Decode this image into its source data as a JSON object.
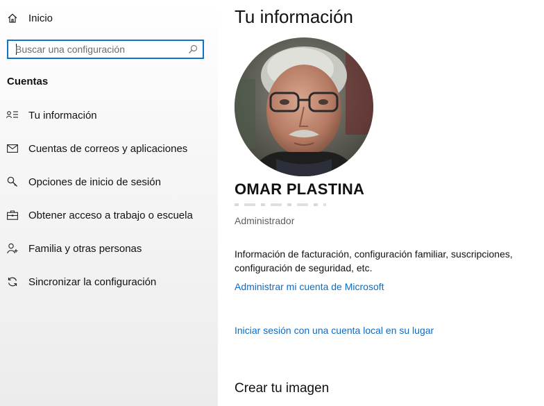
{
  "sidebar": {
    "home_label": "Inicio",
    "search": {
      "placeholder": "Buscar una configuración"
    },
    "section_title": "Cuentas",
    "items": [
      {
        "label": "Tu información",
        "icon": "user-info-icon"
      },
      {
        "label": "Cuentas de correos y aplicaciones",
        "icon": "mail-icon"
      },
      {
        "label": "Opciones de inicio de sesión",
        "icon": "key-icon"
      },
      {
        "label": "Obtener acceso a trabajo o escuela",
        "icon": "briefcase-icon"
      },
      {
        "label": "Familia y otras personas",
        "icon": "person-add-icon"
      },
      {
        "label": "Sincronizar la configuración",
        "icon": "sync-icon"
      }
    ]
  },
  "main": {
    "title": "Tu información",
    "user": {
      "name": "OMAR PLASTINA",
      "role": "Administrador"
    },
    "description": "Información de facturación, configuración familiar, suscripciones, configuración de seguridad, etc.",
    "manage_link": "Administrar mi cuenta de Microsoft",
    "local_link": "Iniciar sesión con una cuenta local en su lugar",
    "create_image_title": "Crear tu imagen"
  },
  "colors": {
    "accent": "#0a74d0",
    "link": "#0a6cc7"
  }
}
